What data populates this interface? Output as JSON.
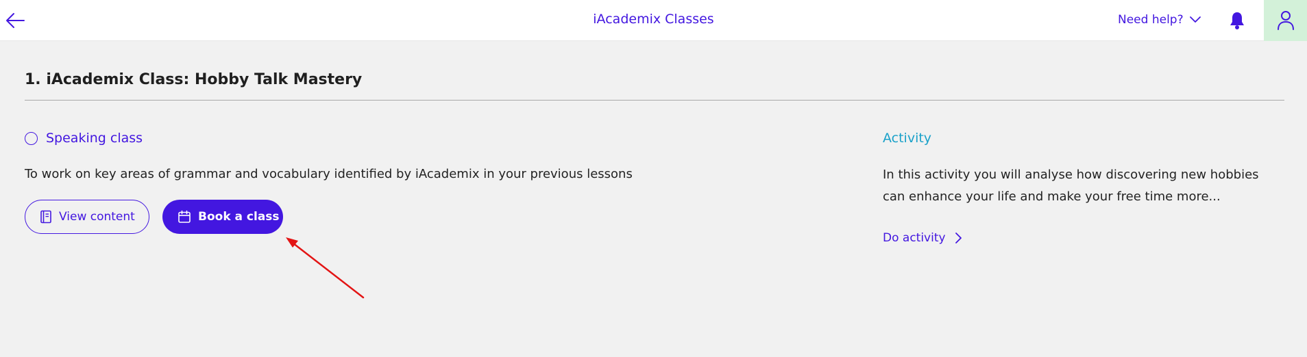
{
  "header": {
    "title": "iAcademix Classes",
    "help_label": "Need help?",
    "back_icon": "arrow-left-icon",
    "help_icon": "chevron-down-icon",
    "notifications_icon": "bell-icon",
    "profile_icon": "user-icon"
  },
  "lesson": {
    "title": "1. iAcademix Class: Hobby Talk Mastery"
  },
  "speaking": {
    "heading": "Speaking class",
    "description": "To work on key areas of grammar and vocabulary identified by iAcademix in your previous lessons",
    "view_content_label": "View content",
    "book_class_label": "Book a class"
  },
  "activity": {
    "heading": "Activity",
    "description": "In this activity you will analyse how discovering new hobbies can enhance your life and make your free time more...",
    "action_label": "Do activity"
  },
  "colors": {
    "primary": "#4317e0",
    "activity_heading": "#1aa1c9",
    "page_background": "#f1f1f1",
    "header_background": "#ffffff",
    "avatar_background": "#d3f1d9",
    "annotation_arrow": "#e31414"
  }
}
